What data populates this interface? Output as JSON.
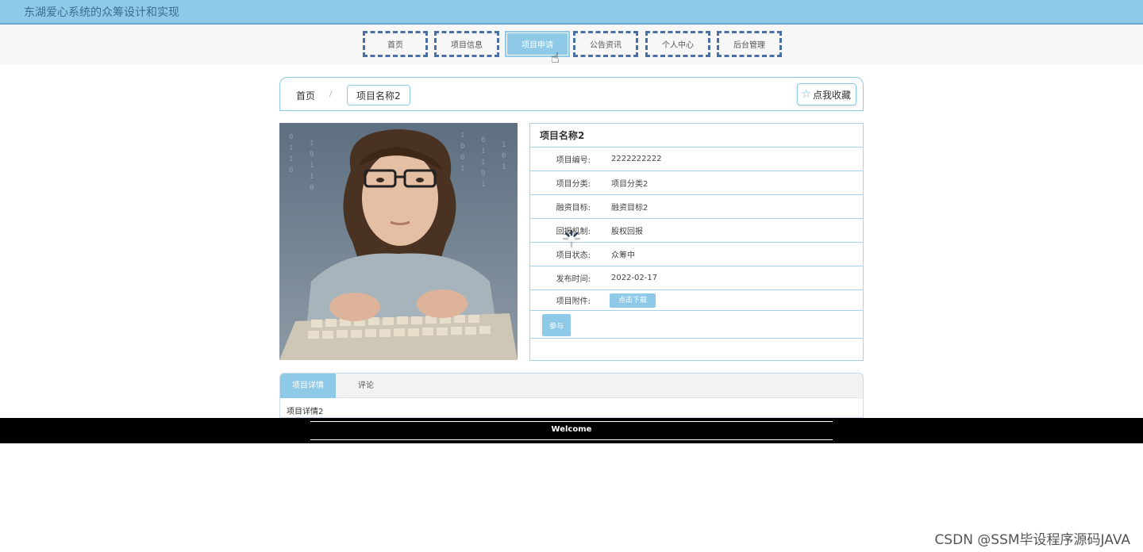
{
  "app": {
    "title": "东湖爱心系统的众筹设计和实现"
  },
  "nav": {
    "items": [
      {
        "label": "首页"
      },
      {
        "label": "项目信息"
      },
      {
        "label": "项目申请"
      },
      {
        "label": "公告资讯"
      },
      {
        "label": "个人中心"
      },
      {
        "label": "后台管理"
      }
    ],
    "active_index": 2
  },
  "breadcrumb": {
    "home": "首页",
    "separator": "/",
    "current": "项目名称2"
  },
  "favorite": {
    "icon": "star-outline-icon",
    "label": "点我收藏"
  },
  "project": {
    "name": "项目名称2",
    "fields": [
      {
        "label": "项目编号:",
        "value": "2222222222"
      },
      {
        "label": "项目分类:",
        "value": "项目分类2"
      },
      {
        "label": "融资目标:",
        "value": "融资目标2"
      },
      {
        "label": "回报机制:",
        "value": "股权回报"
      },
      {
        "label": "项目状态:",
        "value": "众筹中"
      },
      {
        "label": "发布时间:",
        "value": "2022-02-17"
      }
    ],
    "attachment_label": "项目附件:",
    "download_label": "点击下载",
    "join_label": "参与"
  },
  "tabs": {
    "items": [
      {
        "label": "项目详情"
      },
      {
        "label": "评论"
      }
    ],
    "active_index": 0,
    "content": "项目详情2"
  },
  "footer": {
    "text": "Welcome"
  },
  "watermark": "CSDN @SSM毕设程序源码JAVA",
  "colors": {
    "accent": "#8ec9e8",
    "nav_border": "#4a6fa5",
    "footer_bg": "#000000"
  }
}
